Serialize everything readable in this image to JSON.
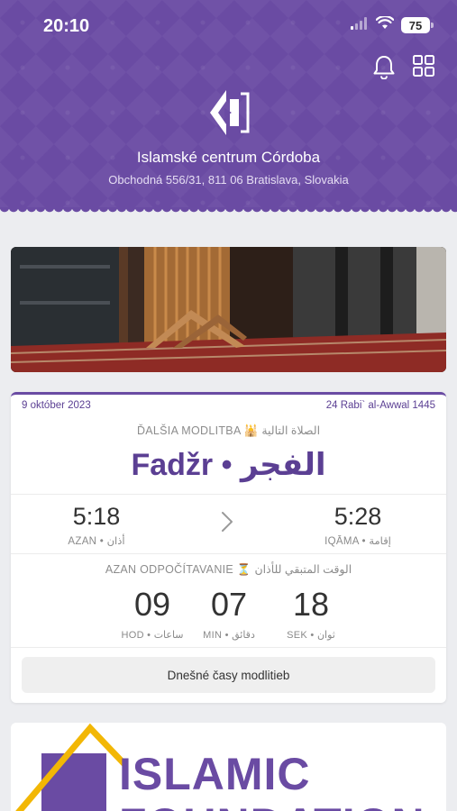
{
  "status_bar": {
    "time": "20:10",
    "battery": "75"
  },
  "header": {
    "org_name": "Islamské centrum Córdoba",
    "address": "Obchodná 556/31, 811 06 Bratislava, Slovakia",
    "icons": [
      "bell-icon",
      "grid-icon"
    ]
  },
  "prayer_card": {
    "gregorian_date": "9 október 2023",
    "hijri_date": "24 Rabi` al-Awwal 1445",
    "next_prayer_label": "ĎALŠIA MODLITBA 🕌 الصلاة التالية",
    "prayer_name": "Fadžr • الفجر",
    "azan_time": "5:18",
    "azan_label": "AZAN • أذان",
    "iqama_time": "5:28",
    "iqama_label": "IQĀMA • إقامة",
    "countdown_label": "AZAN ODPOČÍTAVANIE ⏳ الوقت المتبقي للأذان",
    "countdown": {
      "hours": "09",
      "hours_label": "HOD • ساعات",
      "minutes": "07",
      "minutes_label": "MIN • دقائق",
      "seconds": "18",
      "seconds_label": "SEK • ثوان"
    },
    "today_button": "Dnešné časy modlitieb"
  },
  "banner": {
    "line1": "ISLAMIC",
    "line2": "FOUNDATION"
  },
  "colors": {
    "brand": "#6a4ba3",
    "background": "#ecedf0"
  }
}
